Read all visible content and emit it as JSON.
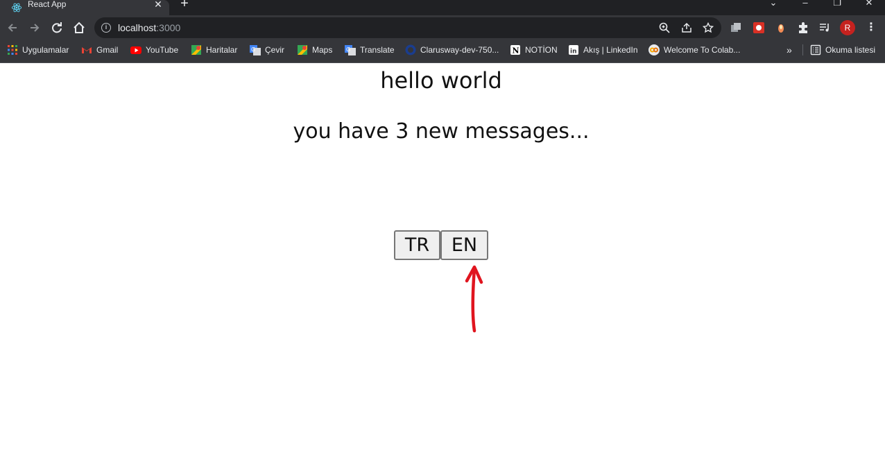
{
  "browser": {
    "tab_title": "React App",
    "tab_close": "✕",
    "new_tab": "+",
    "window_controls": {
      "dropdown": "⌄",
      "minimize": "–",
      "restore": "❐",
      "close": "✕"
    },
    "url_host": "localhost",
    "url_port": ":3000",
    "profile_initial": "R",
    "menu_glyph": "⋮"
  },
  "bookmarks": {
    "items": [
      {
        "label": "Uygulamalar",
        "icon": "apps-grid-icon"
      },
      {
        "label": "Gmail",
        "icon": "gmail-icon"
      },
      {
        "label": "YouTube",
        "icon": "youtube-icon"
      },
      {
        "label": "Haritalar",
        "icon": "maps-icon"
      },
      {
        "label": "Çevir",
        "icon": "translate-icon"
      },
      {
        "label": "Maps",
        "icon": "maps-icon"
      },
      {
        "label": "Translate",
        "icon": "translate-icon"
      },
      {
        "label": "Clarusway-dev-750...",
        "icon": "clarusway-icon"
      },
      {
        "label": "NOTİON",
        "icon": "notion-icon"
      },
      {
        "label": "Akış | LinkedIn",
        "icon": "linkedin-icon"
      },
      {
        "label": "Welcome To Colab...",
        "icon": "colab-icon"
      }
    ],
    "overflow": "»",
    "reading_list": "Okuma listesi"
  },
  "page": {
    "heading": "hello world",
    "message": "you have 3 new messages...",
    "buttons": {
      "tr": "TR",
      "en": "EN"
    }
  },
  "colors": {
    "chrome_dark": "#202124",
    "chrome_toolbar": "#35363a",
    "annotation_arrow": "#e0151f",
    "button_bg": "#efefef"
  }
}
